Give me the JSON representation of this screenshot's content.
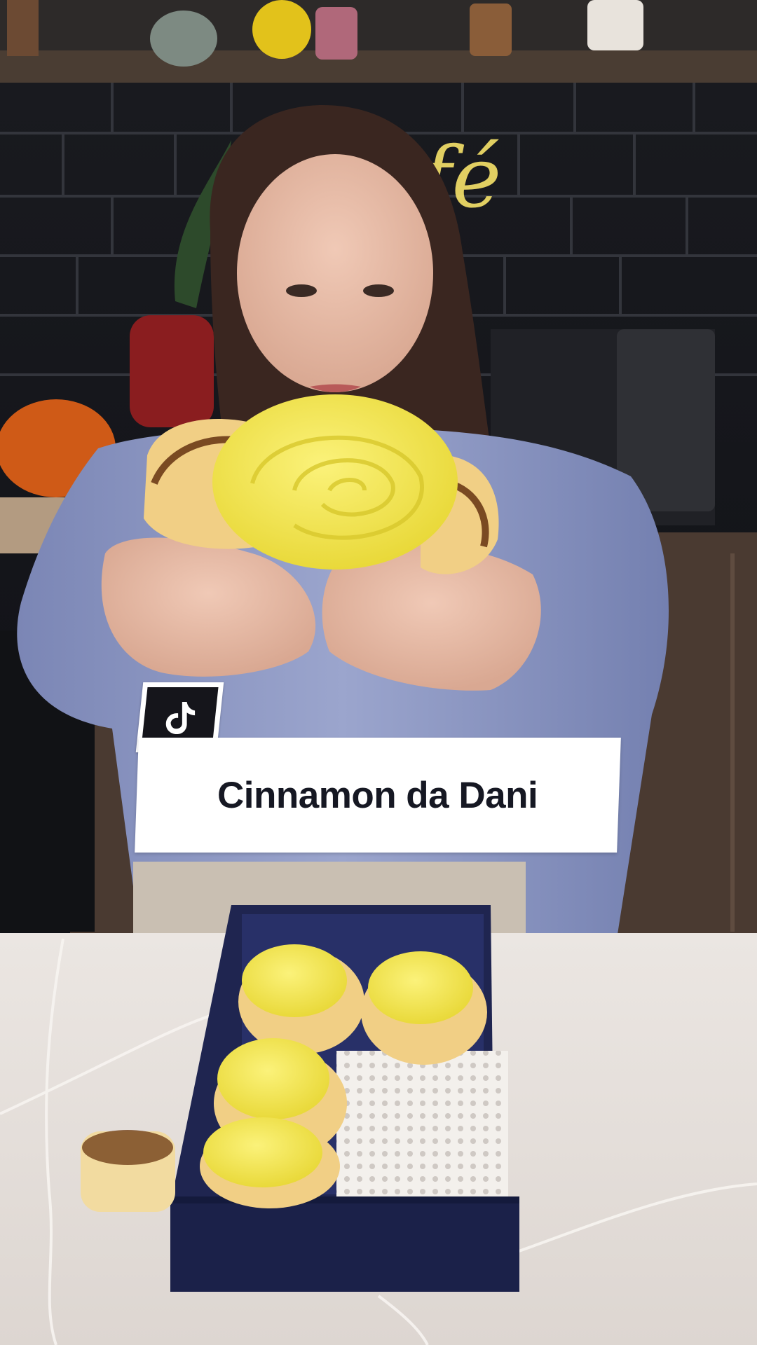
{
  "caption": {
    "text": "Cinnamon da Dani"
  },
  "badge": {
    "icon": "tiktok-logo-icon"
  },
  "colors": {
    "caption_bg": "#ffffff",
    "caption_text": "#161823",
    "badge_bg": "#15151b",
    "frosting": "#f4e64e",
    "box": "#1f2550",
    "shirt": "#8f99c4",
    "tiles": "#17181d",
    "counter": "#e6e0db"
  }
}
